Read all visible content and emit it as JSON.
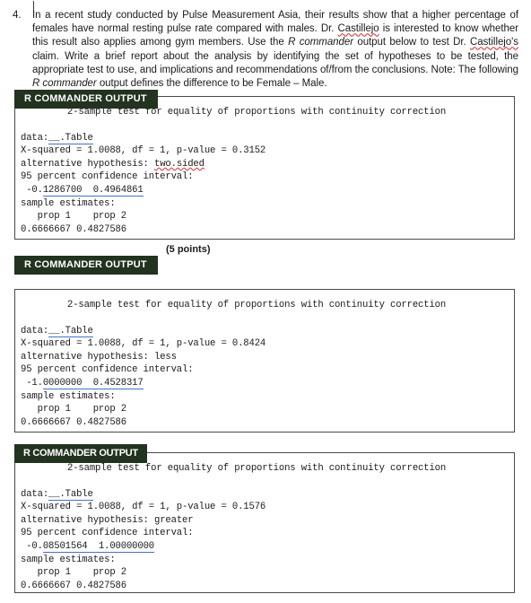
{
  "document": {
    "question_number": "4.",
    "question_parts": [
      {
        "text": "In a recent study conducted by Pulse Measurement Asia, their results show that a higher percentage of females have normal resting pulse rate compared with males. Dr. ",
        "style": "normal"
      },
      {
        "text": "Castillejo",
        "style": "spell-error"
      },
      {
        "text": " is interested to know whether this result also applies among gym members. Use the ",
        "style": "normal"
      },
      {
        "text": "R commander",
        "style": "italic"
      },
      {
        "text": " output below to test Dr. ",
        "style": "normal"
      },
      {
        "text": "Castillejo's",
        "style": "spell-error"
      },
      {
        "text": " claim. Write a brief report about the analysis by identifying the set of hypotheses to be tested, the appropriate test to use, and implications and recommendations of/from the conclusions. Note: The following ",
        "style": "normal"
      },
      {
        "text": "R commander",
        "style": "italic"
      },
      {
        "text": " output defines the difference to be Female – Male.",
        "style": "normal"
      }
    ],
    "points_label": "(5 points)"
  },
  "badge_label": "R COMMANDER OUTPUT",
  "colors": {
    "badge_background": "#22331f",
    "badge_text": "#ffffff",
    "box_border": "#4a4a4a",
    "spell_error_underline": "#d04a4a",
    "grammar_underline": "#4472c4",
    "body_text": "#1a1a1a"
  },
  "outputs": [
    {
      "id": "output-1",
      "title": "2-sample test for equality of proportions with continuity correction",
      "data_label": "data:",
      "data_value": "__.Table",
      "stats_line": "X-squared = 1.0088, df = 1, p-value = 0.3152",
      "alternative_label": "alternative hypothesis: ",
      "alternative_value": "two.sided",
      "alternative_flagged": true,
      "ci_label": "95 percent confidence interval:",
      "ci_prefix": " -0.",
      "ci_values": "1286700  0.4964861",
      "estimates_label": "sample estimates:",
      "prop_header": "   prop 1    prop 2 ",
      "prop_values": "0.6666667 0.4827586"
    },
    {
      "id": "output-2",
      "title": "2-sample test for equality of proportions with continuity correction",
      "data_label": "data:",
      "data_value": "__.Table",
      "stats_line": "X-squared = 1.0088, df = 1, p-value = 0.8424",
      "alternative_label": "alternative hypothesis: ",
      "alternative_value": "less",
      "alternative_flagged": false,
      "ci_label": "95 percent confidence interval:",
      "ci_prefix": " -1.",
      "ci_values": "0000000  0.4528317",
      "estimates_label": "sample estimates:",
      "prop_header": "   prop 1    prop 2 ",
      "prop_values": "0.6666667 0.4827586"
    },
    {
      "id": "output-3",
      "title": "2-sample test for equality of proportions with continuity correction",
      "data_label": "data:",
      "data_value": "__.Table",
      "stats_line": "X-squared = 1.0088, df = 1, p-value = 0.1576",
      "alternative_label": "alternative hypothesis: ",
      "alternative_value": "greater",
      "alternative_flagged": false,
      "ci_label": "95 percent confidence interval:",
      "ci_prefix": " -0.",
      "ci_values": "08501564  1.00000000",
      "estimates_label": "sample estimates:",
      "prop_header": "   prop 1    prop 2 ",
      "prop_values": "0.6666667 0.4827586"
    }
  ]
}
